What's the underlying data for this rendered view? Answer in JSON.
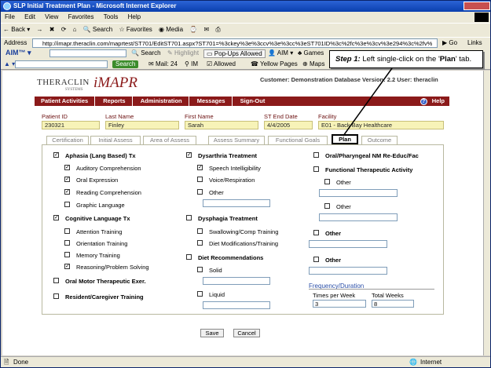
{
  "window": {
    "title": "SLP Initial Treatment Plan - Microsoft Internet Explorer",
    "menu": [
      "File",
      "Edit",
      "View",
      "Favorites",
      "Tools",
      "Help"
    ],
    "toolbar": [
      "Back",
      "Search",
      "Favorites",
      "Media"
    ],
    "address_label": "Address",
    "url": "http://imapr.theraclin.com/maprtest/ST701/EditST701.aspx?ST701=%3ckey%3e%3ccv%3e%3cc%3eST701ID%3c%2fc%3e%3cv%3e294%3c%2fv%",
    "go_label": "Go",
    "links_label": "Links",
    "aim_label": "AIM",
    "aim_search": "Search",
    "highlight": "Highlight",
    "popups": "Pop-Ups Allowed",
    "aim_menu": "AIM",
    "games": "Games",
    "search_btn": "Search",
    "mail": "Mail: 24",
    "im": "IM",
    "allowed": "Allowed",
    "yellow_pages": "Yellow Pages",
    "maps": "Maps",
    "status_done": "Done",
    "status_zone": "Internet"
  },
  "callout": {
    "step": "Step 1:",
    "text": "Left single-click on the '",
    "tab": "Plan",
    "end": "' tab."
  },
  "app": {
    "logo_thera": "THERACLIN",
    "logo_systems": "SYSTEMS",
    "logo_imapr": "iMAPR",
    "customer_line": "Customer: Demonstration Database Version: 2.2 User: theraclin",
    "nav": [
      "Patient Activities",
      "Reports",
      "Administration",
      "Messages",
      "Sign-Out"
    ],
    "help": "Help"
  },
  "patient": {
    "id_label": "Patient ID",
    "id": "230321",
    "last_label": "Last Name",
    "last": "Finley",
    "first_label": "First Name",
    "first": "Sarah",
    "enddate_label": "ST End Date",
    "enddate": "4/4/2005",
    "facility_label": "Facility",
    "facility": "E01 - Back Bay Healthcare"
  },
  "tabs": [
    "Certification",
    "Initial Assess",
    "Area of Assess",
    "Assess Summary",
    "Functional Goals",
    "Plan",
    "Outcome"
  ],
  "plan": {
    "aphasia": "Aphasia (Lang Based) Tx",
    "auditory": "Auditory Comprehension",
    "oral_expr": "Oral Expression",
    "reading": "Reading Comprehension",
    "graphic": "Graphic Language",
    "cognitive": "Cognitive Language Tx",
    "attention": "Attention Training",
    "orientation": "Orientation Training",
    "memory": "Memory Training",
    "reasoning": "Reasoning/Problem Solving",
    "oral_motor": "Oral Motor Therapeutic Exer.",
    "resident": "Resident/Caregiver Training",
    "dysarthria": "Dysarthria Treatment",
    "speech": "Speech Intelligibility",
    "voice": "Voice/Respiration",
    "other": "Other",
    "dysphagia": "Dysphagia Treatment",
    "swallowing": "Swallowing/Comp Training",
    "diet_mod": "Diet Modifications/Training",
    "diet_rec": "Diet Recommendations",
    "solid": "Solid",
    "liquid": "Liquid",
    "oral_pharyn": "Oral/Pharyngeal NM Re-Educ/Fac",
    "functional": "Functional Therapeutic Activity",
    "freq_title": "Frequency/Duration",
    "times_label": "Times per Week",
    "times": "3",
    "weeks_label": "Total Weeks",
    "weeks": "8",
    "save": "Save",
    "cancel": "Cancel"
  }
}
